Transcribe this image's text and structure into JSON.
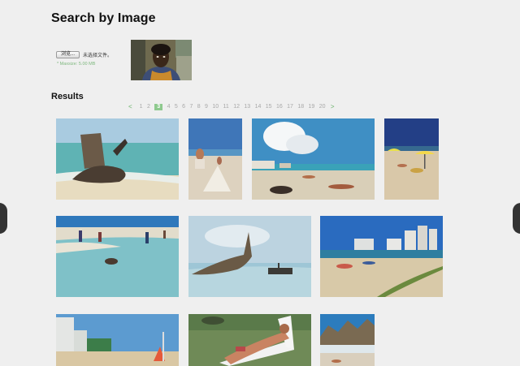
{
  "page": {
    "title": "Search by Image",
    "results_heading": "Results"
  },
  "upload": {
    "browse_label": "浏览...",
    "file_status": "未选择文件。",
    "max_size": "* Maxsize: 5.00 MB"
  },
  "pagination": {
    "prev": "<",
    "next": ">",
    "pages": [
      "1",
      "2",
      "3",
      "4",
      "5",
      "6",
      "7",
      "8",
      "9",
      "10",
      "11",
      "12",
      "13",
      "14",
      "15",
      "16",
      "17",
      "18",
      "19",
      "20"
    ],
    "current": "3"
  },
  "colors": {
    "accent": "#8ec98e",
    "page_link": "#a8a8a8",
    "background": "#efefef"
  },
  "icons": {
    "carousel_prev": "left-arrow-icon",
    "carousel_next": "right-arrow-icon"
  }
}
